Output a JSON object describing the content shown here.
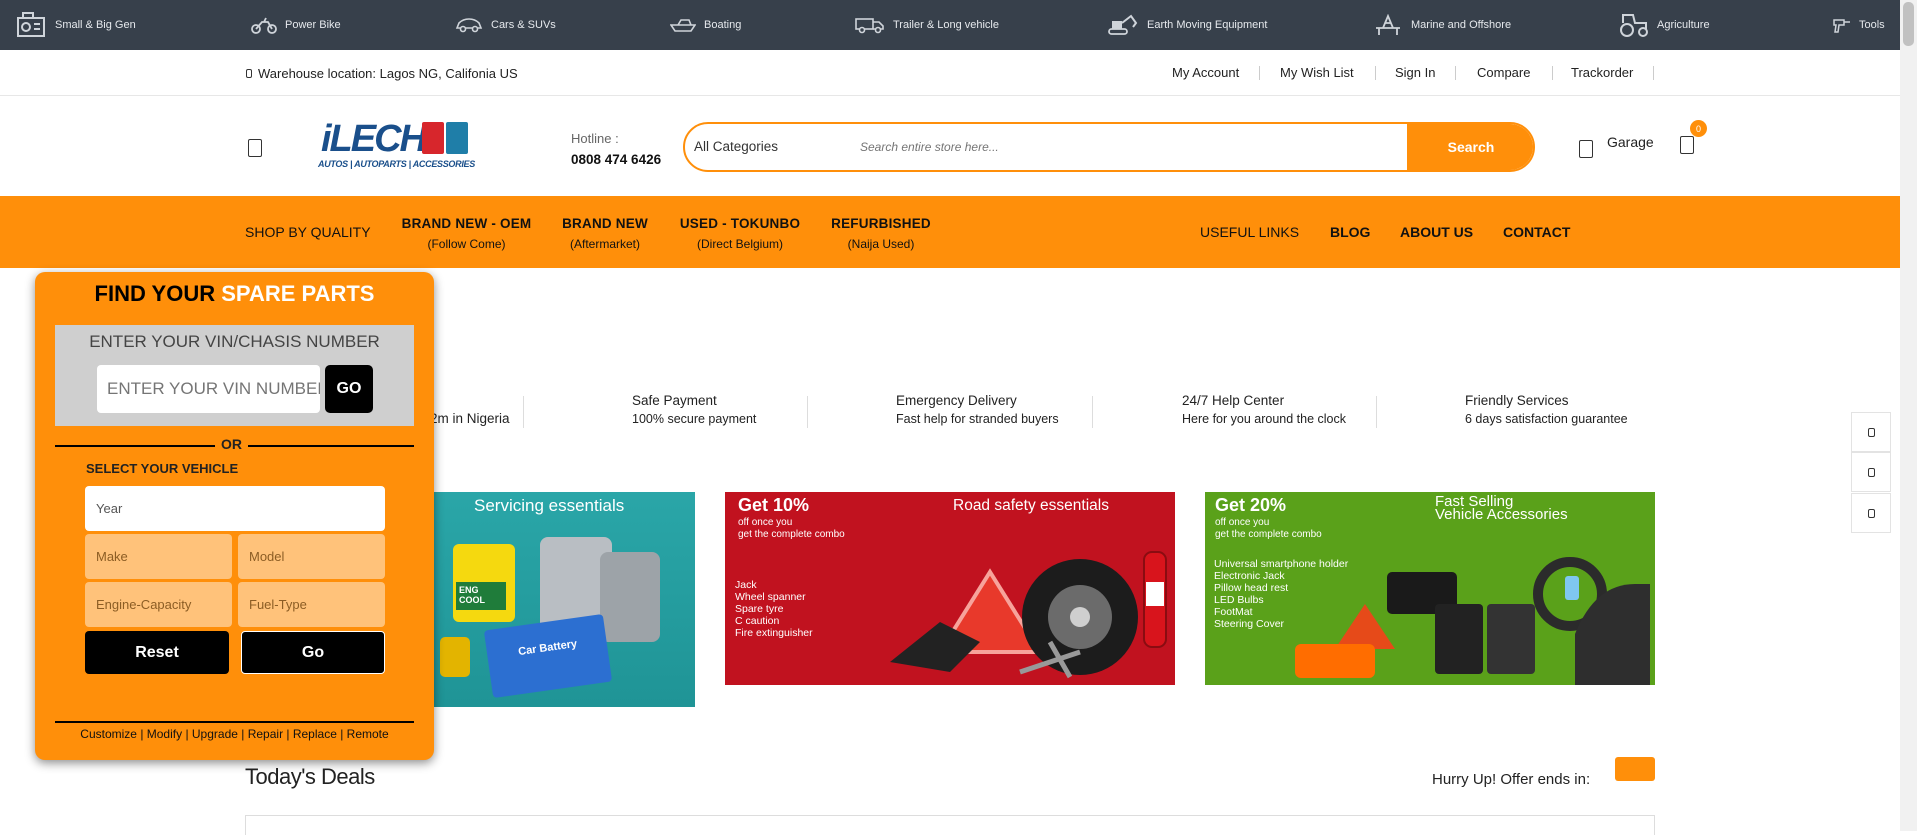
{
  "category_bar": {
    "items": [
      {
        "label": "Small & Big Gen",
        "icon": "generator-icon"
      },
      {
        "label": "Power Bike",
        "icon": "motorbike-icon"
      },
      {
        "label": "Cars & SUVs",
        "icon": "car-icon"
      },
      {
        "label": "Boating",
        "icon": "boat-icon"
      },
      {
        "label": "Trailer & Long vehicle",
        "icon": "truck-icon"
      },
      {
        "label": "Earth Moving Equipment",
        "icon": "excavator-icon"
      },
      {
        "label": "Marine and Offshore",
        "icon": "oil-rig-icon"
      },
      {
        "label": "Agriculture",
        "icon": "tractor-icon"
      },
      {
        "label": "Tools",
        "icon": "drill-icon"
      }
    ]
  },
  "top_links": {
    "warehouse": "Warehouse location: Lagos NG, Califonia US",
    "my_account": "My Account",
    "wish_list": "My Wish List",
    "sign_in": "Sign In",
    "compare": "Compare",
    "trackorder": "Trackorder"
  },
  "header": {
    "logo_text": "iLECH",
    "logo_tagline": "AUTOS | AUTOPARTS | ACCESSORIES",
    "hotline_label": "Hotline :",
    "hotline_number": "0808 474 6426",
    "search_category": "All Categories",
    "search_placeholder": "Search entire store here...",
    "search_button": "Search",
    "garage_label": "Garage",
    "cart_count": "0"
  },
  "nav": {
    "shop_by_quality": "SHOP BY QUALITY",
    "items": [
      {
        "title": "BRAND NEW - OEM",
        "subtitle": "(Follow Come)"
      },
      {
        "title": "BRAND NEW",
        "subtitle": "(Aftermarket)"
      },
      {
        "title": "USED - TOKUNBO",
        "subtitle": "(Direct Belgium)"
      },
      {
        "title": "REFURBISHED",
        "subtitle": "(Naija Used)"
      }
    ],
    "useful_links": "USEFUL LINKS",
    "blog": "BLOG",
    "about": "ABOUT US",
    "contact": "CONTACT"
  },
  "features": [
    {
      "title": "",
      "subtitle": "2m in Nigeria"
    },
    {
      "title": "Safe Payment",
      "subtitle": "100% secure payment"
    },
    {
      "title": "Emergency Delivery",
      "subtitle": "Fast help for stranded buyers"
    },
    {
      "title": "24/7 Help Center",
      "subtitle": "Here for you around the clock"
    },
    {
      "title": "Friendly Services",
      "subtitle": "6 days satisfaction guarantee"
    }
  ],
  "banners": {
    "servicing": {
      "title": "Servicing essentials",
      "battery_label": "Car Battery",
      "coolant_label": "ENG COOL"
    },
    "road_safety": {
      "headline": "Get 10%",
      "sub1": "off once you",
      "sub2": "get the complete combo",
      "title": "Road safety essentials",
      "items": [
        "Jack",
        "Wheel spanner",
        "Spare tyre",
        "C caution",
        "Fire extinguisher"
      ]
    },
    "accessories": {
      "headline": "Get 20%",
      "sub1": "off once you",
      "sub2": "get the complete combo",
      "title1": "Fast Selling",
      "title2": "Vehicle Accessories",
      "items": [
        "Universal smartphone holder",
        "Electronic Jack",
        "Pillow head rest",
        "LED Bulbs",
        "FootMat",
        "Steering Cover"
      ]
    }
  },
  "part_finder": {
    "title_black": "FIND YOUR",
    "title_white": "SPARE PARTS",
    "vin_heading": "ENTER YOUR VIN/CHASIS NUMBER",
    "vin_placeholder": "ENTER YOUR VIN NUMBER",
    "vin_go": "GO",
    "or": "OR",
    "select_vehicle": "SELECT YOUR VEHICLE",
    "year": "Year",
    "make": "Make",
    "model": "Model",
    "engine_capacity": "Engine-Capacity",
    "fuel_type": "Fuel-Type",
    "reset": "Reset",
    "go": "Go",
    "footer": "Customize | Modify | Upgrade | Repair | Replace | Remote"
  },
  "deals": {
    "title": "Today's Deals",
    "hurry": "Hurry Up! Offer ends in:"
  },
  "colors": {
    "accent": "#ff8f0a",
    "category_bar": "#37404b",
    "red_banner": "#c1121f",
    "green_banner": "#5aa11a",
    "teal_banner": "#2aa6a8"
  }
}
